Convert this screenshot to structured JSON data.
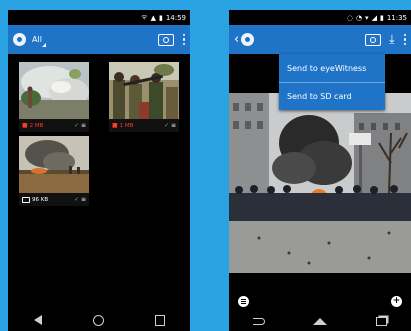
{
  "left_phone": {
    "statusbar": {
      "time": "14:59"
    },
    "appbar": {
      "title": "All",
      "logo_icon": "eyewitness-logo-icon",
      "camera_icon": "camera-icon",
      "menu_icon": "overflow-menu-icon"
    },
    "thumbnails": [
      {
        "kind": "video",
        "size": "2 MB",
        "size_color": "#ff3a2a",
        "uploaded": true
      },
      {
        "kind": "video",
        "size": "1 MB",
        "size_color": "#ff3a2a",
        "uploaded": true
      },
      {
        "kind": "photo",
        "size": "96 KB",
        "size_color": "#ffffff",
        "uploaded": true
      }
    ],
    "navbar": [
      "back-icon",
      "home-icon",
      "recents-icon"
    ]
  },
  "right_phone": {
    "statusbar": {
      "time": "11:35"
    },
    "appbar": {
      "back_icon": "chevron-left-icon",
      "logo_icon": "eyewitness-logo-icon",
      "camera_icon": "camera-icon",
      "upload_icon": "upload-icon",
      "menu_icon": "overflow-menu-icon"
    },
    "menu": {
      "items": [
        "Send to eyeWitness",
        "Send to SD card"
      ]
    },
    "bottom_bar": {
      "left_icon": "list-icon",
      "right_icon": "add-icon"
    },
    "navbar": [
      "back-icon",
      "home-icon",
      "recents-icon"
    ]
  },
  "colors": {
    "page_bg": "#2ba3e3",
    "appbar": "#1f74c8",
    "accent_red": "#ff3a2a",
    "check_green": "#3fd23f"
  }
}
